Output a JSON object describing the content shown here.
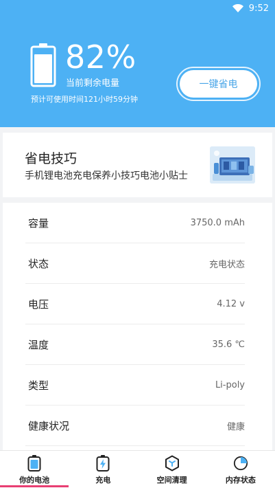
{
  "status_bar": {
    "time": "9:52"
  },
  "battery": {
    "percent_text": "82%",
    "percent_label": "当前剩余电量",
    "estimate": "预计可使用时间121小时59分钟",
    "save_button": "一键省电",
    "level": 0.82
  },
  "tips": {
    "title": "省电技巧",
    "subtitle": "手机锂电池充电保养小技巧电池小贴士"
  },
  "info_rows": [
    {
      "label": "容量",
      "value": "3750.0 mAh"
    },
    {
      "label": "状态",
      "value": "充电状态"
    },
    {
      "label": "电压",
      "value": "4.12 v"
    },
    {
      "label": "温度",
      "value": "35.6 ℃"
    },
    {
      "label": "类型",
      "value": "Li-poly"
    },
    {
      "label": "健康状况",
      "value": "健康"
    }
  ],
  "tabs": [
    {
      "label": "你的电池",
      "icon": "battery-icon"
    },
    {
      "label": "充电",
      "icon": "charge-icon"
    },
    {
      "label": "空间清理",
      "icon": "cleanup-icon"
    },
    {
      "label": "内存状态",
      "icon": "memory-pie-icon"
    }
  ],
  "colors": {
    "header": "#4db1f4",
    "accent": "#4aa6e8",
    "active_tab": "#e83e72"
  }
}
